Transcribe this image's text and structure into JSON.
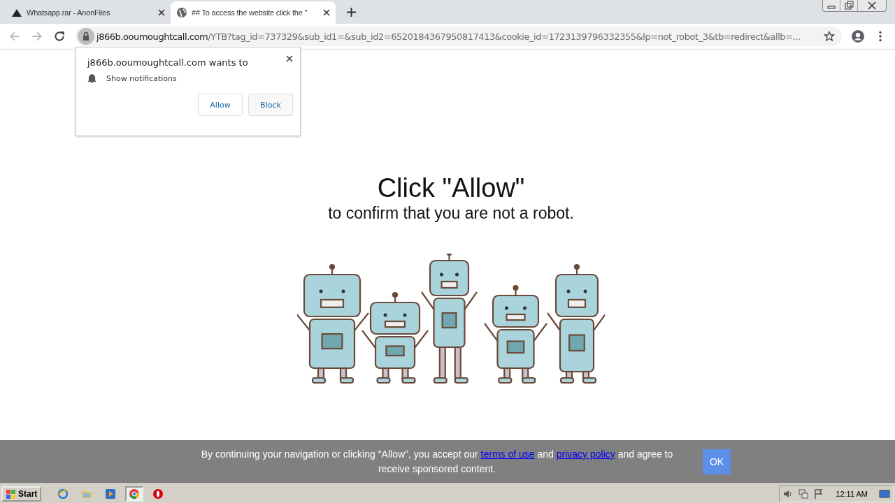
{
  "tabs": [
    {
      "title": "Whatsapp.rar - AnonFiles",
      "selected": false
    },
    {
      "title": "## To access the website click the \"",
      "selected": true
    }
  ],
  "address_bar": {
    "host": "j866b.ooumoughtcall.com",
    "path": "/YTB?tag_id=737329&sub_id1=&sub_id2=6520184367950817413&cookie_id=1723139796332355&lp=not_robot_3&tb=redirect&allb=..."
  },
  "permission_popup": {
    "title": "j866b.ooumoughtcall.com wants to",
    "permission": "Show notifications",
    "buttons": [
      "Allow",
      "Block"
    ]
  },
  "page": {
    "heading": "Click \"Allow\"",
    "subheading": "to confirm that you are not a robot."
  },
  "cookie_bar": {
    "text_before": "By continuing your navigation or clicking \"Allow\", you accept our",
    "link_1": "terms of use",
    "text_middle": "and",
    "link_2": "privacy policy",
    "text_after": "and agree to receive sponsored content.",
    "button": "OK"
  },
  "taskbar": {
    "start": "Start",
    "pinned": [
      {
        "kind": "ie",
        "active": false
      },
      {
        "kind": "folder",
        "active": false
      },
      {
        "kind": "media",
        "active": false
      },
      {
        "kind": "chrome",
        "active": true
      },
      {
        "kind": "opera",
        "active": false
      }
    ],
    "clock": "12:11 AM"
  }
}
